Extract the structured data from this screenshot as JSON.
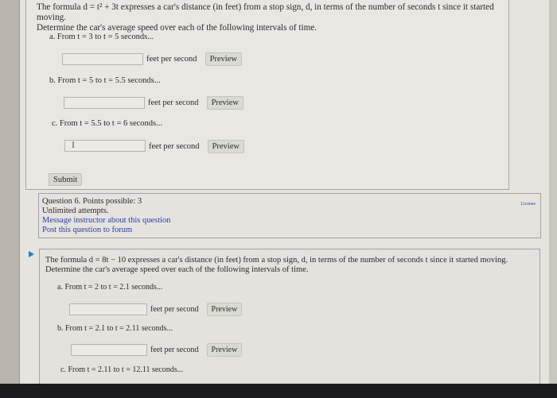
{
  "question5": {
    "intro_line1": "The formula d = t² + 3t expresses a car's distance (in feet) from a stop sign, d, in terms of the number of seconds t since it started moving.",
    "intro_line2": "Determine the car's average speed over each of the following intervals of time.",
    "parts": [
      {
        "label": "a. From t = 3 to t = 5 seconds...",
        "value": "",
        "unit": "feet per second",
        "preview": "Preview"
      },
      {
        "label": "b. From t = 5 to t = 5.5 seconds...",
        "value": "",
        "unit": "feet per second",
        "preview": "Preview"
      },
      {
        "label": "c. From t = 5.5 to t = 6 seconds...",
        "value": "",
        "unit": "feet per second",
        "preview": "Preview"
      }
    ],
    "cursor_glyph": "I",
    "submit": "Submit"
  },
  "info": {
    "points": "Question 6. Points possible: 3",
    "attempts": "Unlimited attempts.",
    "message_link": "Message instructor about this question",
    "forum_link": "Post this question to forum",
    "license": "License"
  },
  "question6": {
    "intro_line1": "The formula d = 8t − 10 expresses a car's distance (in feet) from a stop sign, d, in terms of the number of seconds t since it started moving.",
    "intro_line2": "Determine the car's average speed over each of the following intervals of time.",
    "parts": [
      {
        "label": "a. From t = 2 to t = 2.1 seconds...",
        "value": "",
        "unit": "feet per second",
        "preview": "Preview"
      },
      {
        "label": "b. From t = 2.1 to t = 2.11 seconds...",
        "value": "",
        "unit": "feet per second",
        "preview": "Preview"
      },
      {
        "label": "c. From t = 2.11 to t = 12.11 seconds..."
      }
    ]
  }
}
